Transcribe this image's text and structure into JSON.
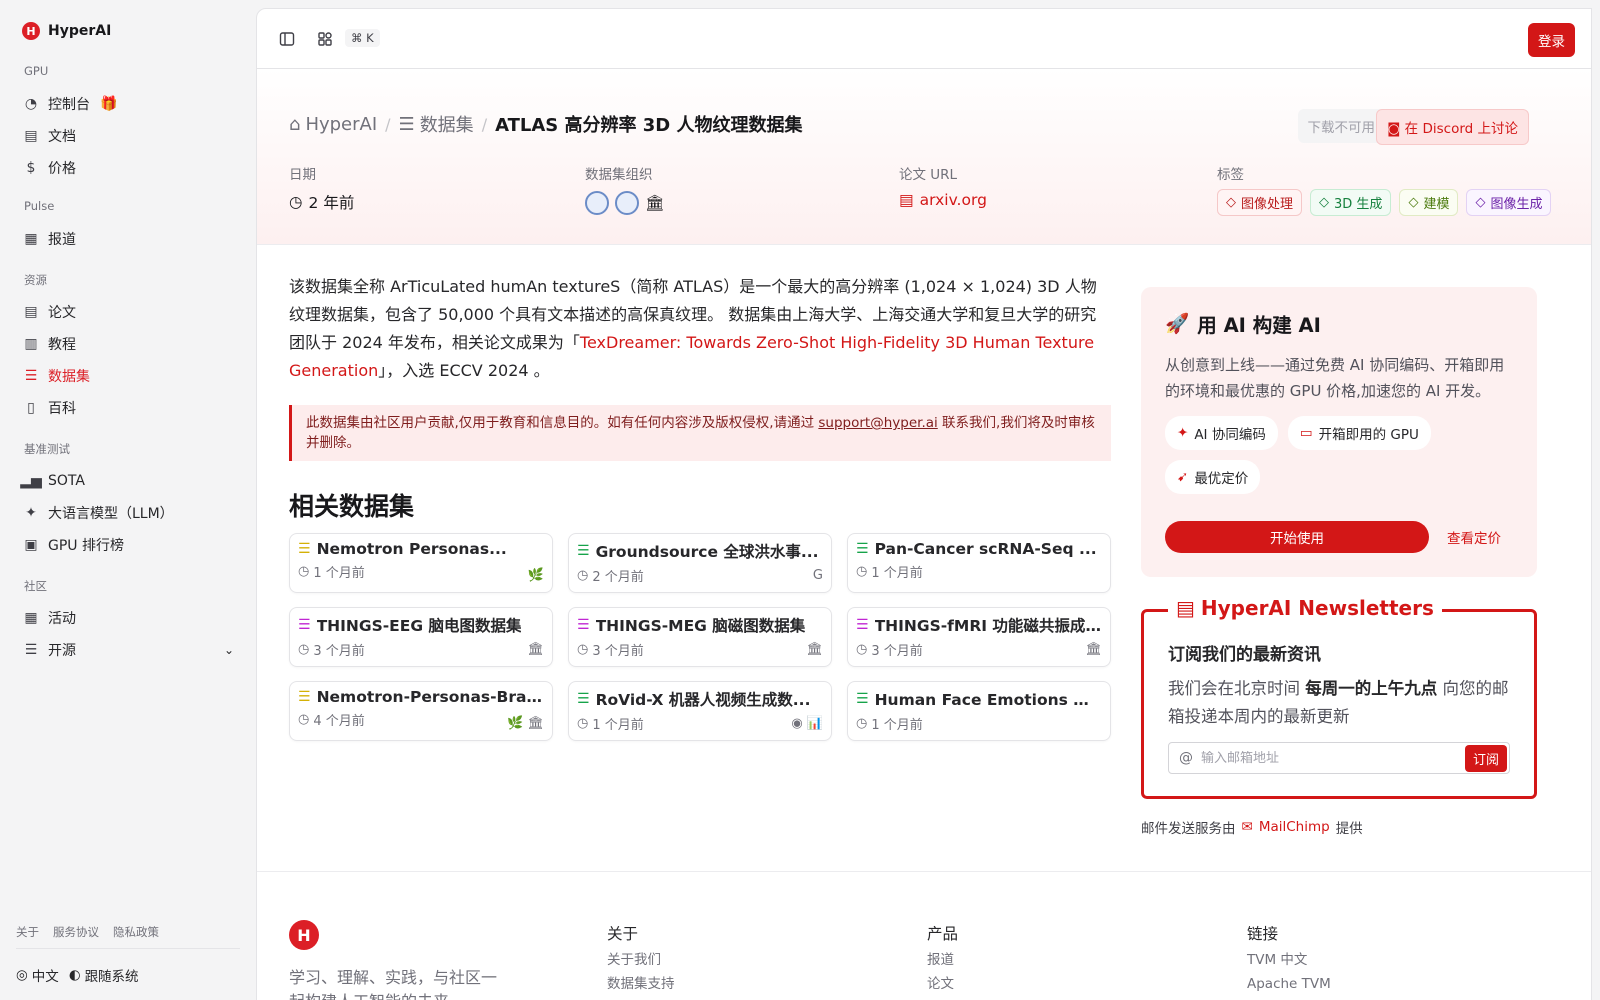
{
  "brand": {
    "name": "HyperAI",
    "logo_text": "H"
  },
  "sidebar": {
    "sections": [
      {
        "label": "GPU",
        "items": [
          {
            "label": "控制台",
            "icon": "dashboard-icon",
            "badge": "gift-icon"
          },
          {
            "label": "文档",
            "icon": "doc-icon"
          },
          {
            "label": "价格",
            "icon": "dollar-icon"
          }
        ]
      },
      {
        "label": "Pulse",
        "items": [
          {
            "label": "报道",
            "icon": "news-icon"
          }
        ]
      },
      {
        "label": "资源",
        "items": [
          {
            "label": "论文",
            "icon": "paper-icon"
          },
          {
            "label": "教程",
            "icon": "tutorial-icon"
          },
          {
            "label": "数据集",
            "icon": "database-icon",
            "active": true
          },
          {
            "label": "百科",
            "icon": "book-icon"
          }
        ]
      },
      {
        "label": "基准测试",
        "items": [
          {
            "label": "SOTA",
            "icon": "chart-icon"
          },
          {
            "label": "大语言模型（LLM）",
            "icon": "sparkle-icon"
          },
          {
            "label": "GPU 排行榜",
            "icon": "cpu-icon"
          }
        ]
      },
      {
        "label": "社区",
        "items": [
          {
            "label": "活动",
            "icon": "calendar-icon"
          },
          {
            "label": "开源",
            "icon": "list-icon"
          }
        ]
      }
    ],
    "footer_links": [
      "关于",
      "服务协议",
      "隐私政策"
    ],
    "language": "中文",
    "theme": "跟随系统"
  },
  "topbar": {
    "shortcut": "⌘ K",
    "login": "登录"
  },
  "breadcrumb": {
    "home": "HyperAI",
    "section": "数据集",
    "current": "ATLAS 高分辨率 3D 人物纹理数据集"
  },
  "actions": {
    "download": "下载不可用",
    "discord": "在 Discord 上讨论"
  },
  "meta": {
    "date_label": "日期",
    "date_value": "2 年前",
    "org_label": "数据集组织",
    "url_label": "论文 URL",
    "url_value": "arxiv.org",
    "tags_label": "标签",
    "tags": [
      {
        "label": "图像处理",
        "color": "red"
      },
      {
        "label": "3D 生成",
        "color": "green"
      },
      {
        "label": "建模",
        "color": "olive"
      },
      {
        "label": "图像生成",
        "color": "purple"
      }
    ]
  },
  "description": {
    "part1": "该数据集全称 ArTicuLated humAn textureS（简称 ATLAS）是一个最大的高分辨率 (1,024 × 1,024) 3D 人物纹理数据集，包含了 50,000 个具有文本描述的高保真纹理。 数据集由上海大学、上海交通大学和复旦大学的研究团队于 2024 年发布，相关论文成果为「",
    "link": "TexDreamer: Towards Zero-Shot High-Fidelity 3D Human Texture Generation",
    "part2": "」，入选 ECCV 2024 。"
  },
  "notice": {
    "text1": "此数据集由社区用户贡献,仅用于教育和信息目的。如有任何内容涉及版权侵权,请通过 ",
    "email": "support@hyper.ai",
    "text2": " 联系我们,我们将及时审核并删除。"
  },
  "related": {
    "title": "相关数据集",
    "cards": [
      {
        "title": "Nemotron Personas...",
        "time": "1 个月前",
        "icon_color": "#d4b106",
        "logos": "🌿"
      },
      {
        "title": "Groundsource 全球洪水事...",
        "time": "2 个月前",
        "icon_color": "#16a34a",
        "logos": "G"
      },
      {
        "title": "Pan-Cancer scRNA-Seq ...",
        "time": "1 个月前",
        "icon_color": "#16a34a",
        "logos": ""
      },
      {
        "title": "THINGS-EEG 脑电图数据集",
        "time": "3 个月前",
        "icon_color": "#c026d3",
        "logos": "🏛"
      },
      {
        "title": "THINGS-MEG 脑磁图数据集",
        "time": "3 个月前",
        "icon_color": "#c026d3",
        "logos": "🏛"
      },
      {
        "title": "THINGS-fMRI 功能磁共振成...",
        "time": "3 个月前",
        "icon_color": "#c026d3",
        "logos": "🏛"
      },
      {
        "title": "Nemotron-Personas-Bra...",
        "time": "4 个月前",
        "icon_color": "#d4b106",
        "logos": "🌿 🏛"
      },
      {
        "title": "RoVid-X 机器人视频生成数...",
        "time": "1 个月前",
        "icon_color": "#16a34a",
        "logos": "◉ 📊"
      },
      {
        "title": "Human Face Emotions 人...",
        "time": "1 个月前",
        "icon_color": "#16a34a",
        "logos": ""
      }
    ]
  },
  "aside": {
    "title": "用 AI 构建 AI",
    "text": "从创意到上线——通过免费 AI 协同编码、开箱即用的环境和最优惠的 GPU 价格,加速您的 AI 开发。",
    "chips": [
      "AI 协同编码",
      "开箱即用的 GPU",
      "最优定价"
    ],
    "start": "开始使用",
    "pricing": "查看定价"
  },
  "newsletter": {
    "legend": "HyperAI Newsletters",
    "title": "订阅我们的最新资讯",
    "text1": "我们会在北京时间 ",
    "bold": "每周一的上午九点",
    "text2": " 向您的邮箱投递本周内的最新更新",
    "placeholder": "输入邮箱地址",
    "subscribe": "订阅",
    "provider_prefix": "邮件发送服务由",
    "provider": "MailChimp",
    "provider_suffix": "提供"
  },
  "footer": {
    "tagline": "学习、理解、实践，与社区一起构建人工智能的未来",
    "columns": [
      {
        "title": "关于",
        "links": [
          "关于我们",
          "数据集支持"
        ]
      },
      {
        "title": "产品",
        "links": [
          "报道",
          "论文"
        ]
      },
      {
        "title": "链接",
        "links": [
          "TVM 中文",
          "Apache TVM"
        ]
      }
    ]
  },
  "colors": {
    "accent": "#d31717",
    "sidebar_bg": "#f4f4f5"
  }
}
